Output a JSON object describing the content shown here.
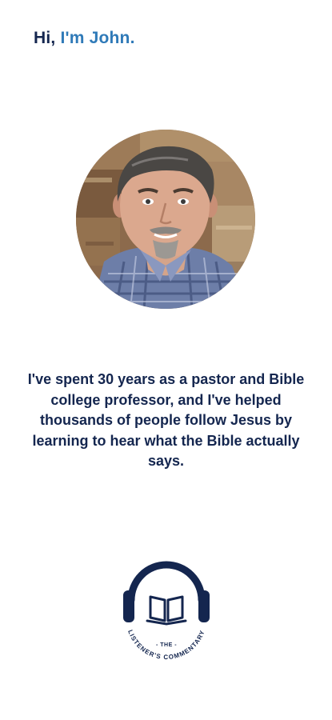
{
  "header": {
    "greeting_prefix": "Hi, ",
    "greeting_name": "I'm John."
  },
  "bio": {
    "text": "I've spent 30 years as a pastor and Bible college professor, and I've helped thousands of people follow Jesus by learning to hear what the Bible actually says."
  },
  "logo": {
    "top_text": "- THE -",
    "arc_text": "LISTENER'S COMMENTARY"
  },
  "colors": {
    "navy": "#14264f",
    "accent_blue": "#2f7ab8",
    "background": "#ffffff"
  }
}
